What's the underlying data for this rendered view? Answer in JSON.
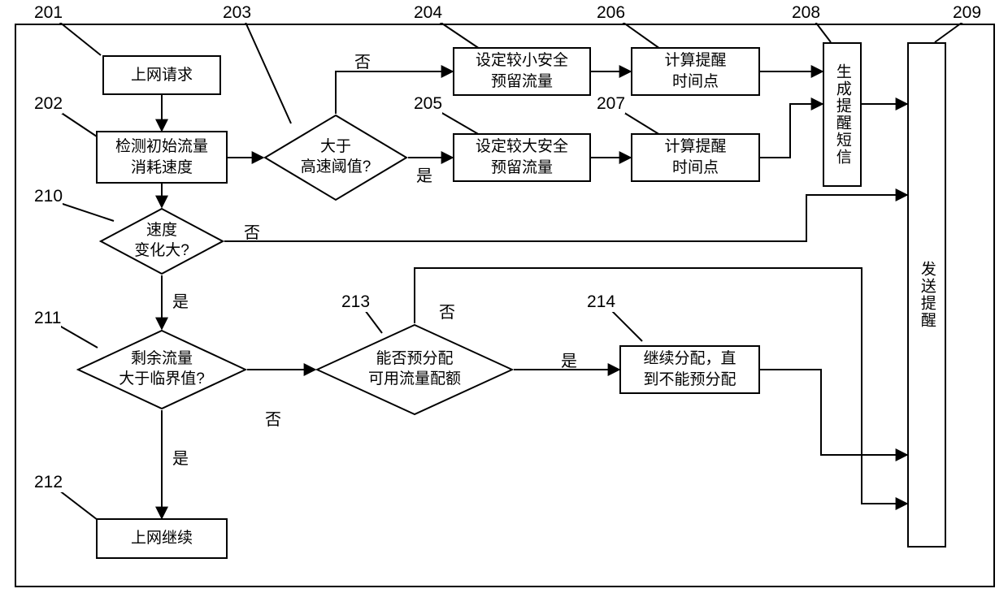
{
  "nodes": {
    "n201": {
      "num": "201",
      "label": "上网请求"
    },
    "n202": {
      "num": "202",
      "label": "检测初始流量\n消耗速度"
    },
    "n203": {
      "num": "203",
      "label": "大于\n高速阈值?"
    },
    "n204": {
      "num": "204",
      "label": "设定较小安全\n预留流量"
    },
    "n205": {
      "num": "205",
      "label": "设定较大安全\n预留流量"
    },
    "n206": {
      "num": "206",
      "label": "计算提醒\n时间点"
    },
    "n207": {
      "num": "207",
      "label": "计算提醒\n时间点"
    },
    "n208": {
      "num": "208",
      "label": "生成提醒短信"
    },
    "n209": {
      "num": "209",
      "label": "发送提醒"
    },
    "n210": {
      "num": "210",
      "label": "速度\n变化大?"
    },
    "n211": {
      "num": "211",
      "label": "剩余流量\n大于临界值?"
    },
    "n212": {
      "num": "212",
      "label": "上网继续"
    },
    "n213": {
      "num": "213",
      "label": "能否预分配\n可用流量配额"
    },
    "n214": {
      "num": "214",
      "label": "继续分配，直\n到不能预分配"
    }
  },
  "branch": {
    "yes": "是",
    "no": "否"
  }
}
